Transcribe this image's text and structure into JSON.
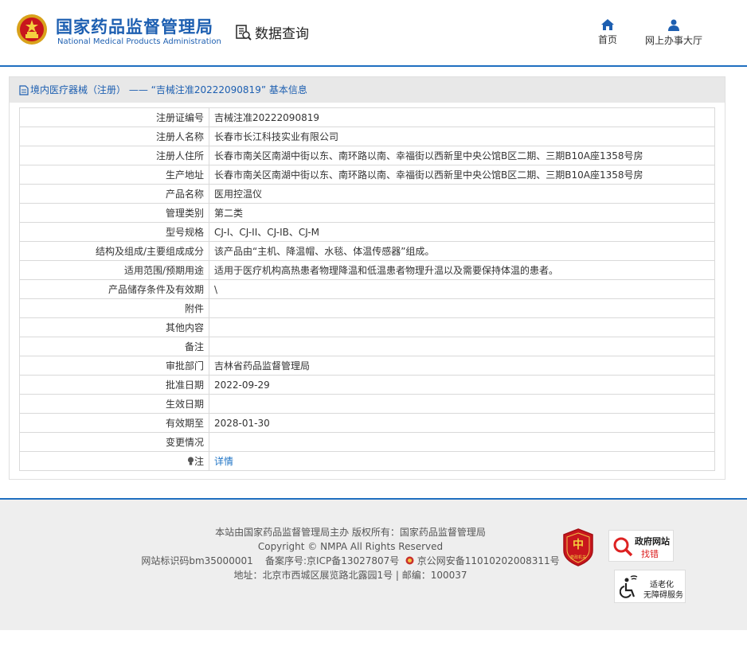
{
  "header": {
    "org_name_cn": "国家药品监督管理局",
    "org_name_en": "National Medical Products Administration",
    "search_label": "数据查询",
    "nav": [
      {
        "label": "首页",
        "icon": "home-icon"
      },
      {
        "label": "网上办事大厅",
        "icon": "user-icon"
      }
    ]
  },
  "panel": {
    "title": "境内医疗器械（注册） —— “吉械注准20222090819” 基本信息",
    "rows": [
      {
        "key": "注册证编号",
        "value": "吉械注准20222090819"
      },
      {
        "key": "注册人名称",
        "value": "长春市长江科技实业有限公司"
      },
      {
        "key": "注册人住所",
        "value": "长春市南关区南湖中街以东、南环路以南、幸福街以西新里中央公馆B区二期、三期B10A座1358号房"
      },
      {
        "key": "生产地址",
        "value": "长春市南关区南湖中街以东、南环路以南、幸福街以西新里中央公馆B区二期、三期B10A座1358号房"
      },
      {
        "key": "产品名称",
        "value": "医用控温仪"
      },
      {
        "key": "管理类别",
        "value": "第二类"
      },
      {
        "key": "型号规格",
        "value": "CJ-I、CJ-II、CJ-IB、CJ-M"
      },
      {
        "key": "结构及组成/主要组成成分",
        "value": "该产品由“主机、降温帽、水毯、体温传感器”组成。"
      },
      {
        "key": "适用范围/预期用途",
        "value": "适用于医疗机构高热患者物理降温和低温患者物理升温以及需要保持体温的患者。"
      },
      {
        "key": "产品储存条件及有效期",
        "value": "\\"
      },
      {
        "key": "附件",
        "value": ""
      },
      {
        "key": "其他内容",
        "value": ""
      },
      {
        "key": "备注",
        "value": ""
      },
      {
        "key": "审批部门",
        "value": "吉林省药品监督管理局"
      },
      {
        "key": "批准日期",
        "value": "2022-09-29"
      },
      {
        "key": "生效日期",
        "value": ""
      },
      {
        "key": "有效期至",
        "value": "2028-01-30"
      },
      {
        "key": "变更情况",
        "value": ""
      }
    ],
    "note_key": "注",
    "note_link": "详情"
  },
  "footer": {
    "line1": "本站由国家药品监督管理局主办 版权所有：国家药品监督管理局",
    "line2": "Copyright © NMPA All Rights Reserved",
    "line3_site": "网站标识码bm35000001",
    "line3_icp": "备案序号:京ICP备13027807号",
    "line3_police": "京公网安备11010202008311号",
    "line4": "地址：北京市西城区展览路北露园1号 | 邮编：100037",
    "badge_gov_line1": "政府网站",
    "badge_gov_line2": "找错",
    "badge_acc_line1": "适老化",
    "badge_acc_line2": "无障碍服务",
    "badge_party_text": "党政机关"
  },
  "colors": {
    "brand_blue": "#1d5fb1",
    "link_blue": "#1f74c6",
    "title_bar": "#e8e8e8",
    "footer_bg": "#eeeeee"
  }
}
